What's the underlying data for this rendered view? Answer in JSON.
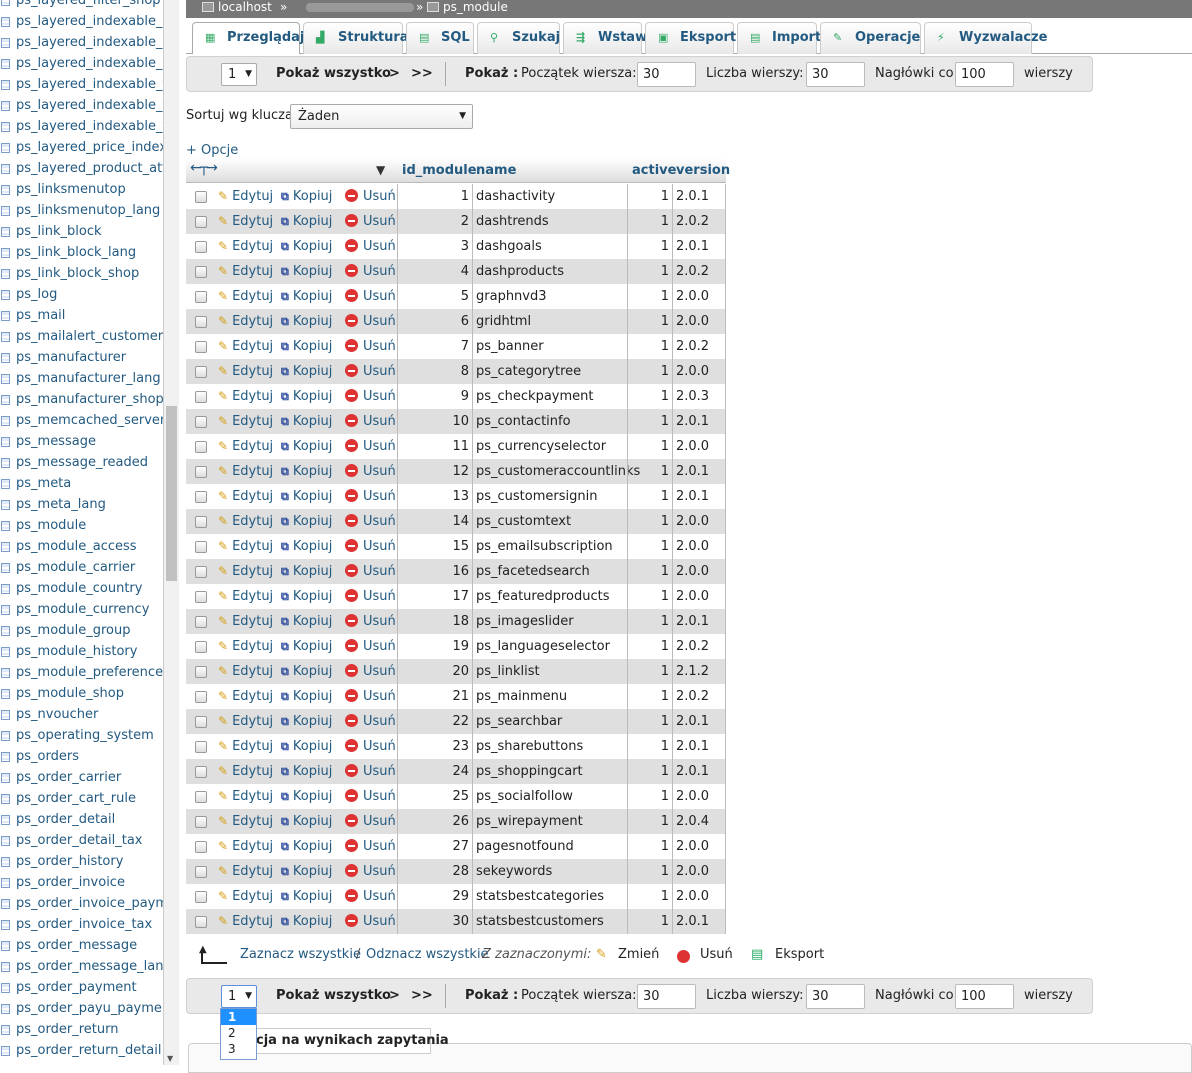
{
  "sidebar": {
    "tables": [
      "ps_layered_filter_shop",
      "ps_layered_indexable_attr",
      "ps_layered_indexable_attr",
      "ps_layered_indexable_attr",
      "ps_layered_indexable_feat",
      "ps_layered_indexable_feat",
      "ps_layered_indexable_feat",
      "ps_layered_price_index",
      "ps_layered_product_attrib",
      "ps_linksmenutop",
      "ps_linksmenutop_lang",
      "ps_link_block",
      "ps_link_block_lang",
      "ps_link_block_shop",
      "ps_log",
      "ps_mail",
      "ps_mailalert_customer_oos",
      "ps_manufacturer",
      "ps_manufacturer_lang",
      "ps_manufacturer_shop",
      "ps_memcached_servers",
      "ps_message",
      "ps_message_readed",
      "ps_meta",
      "ps_meta_lang",
      "ps_module",
      "ps_module_access",
      "ps_module_carrier",
      "ps_module_country",
      "ps_module_currency",
      "ps_module_group",
      "ps_module_history",
      "ps_module_preference",
      "ps_module_shop",
      "ps_nvoucher",
      "ps_operating_system",
      "ps_orders",
      "ps_order_carrier",
      "ps_order_cart_rule",
      "ps_order_detail",
      "ps_order_detail_tax",
      "ps_order_history",
      "ps_order_invoice",
      "ps_order_invoice_payment",
      "ps_order_invoice_tax",
      "ps_order_message",
      "ps_order_message_lang",
      "ps_order_payment",
      "ps_order_payu_payments",
      "ps_order_return",
      "ps_order_return_detail"
    ]
  },
  "breadcrumb": {
    "server": "localhost",
    "sep1": "»",
    "sep2": "»",
    "table": "ps_module"
  },
  "tabs": [
    {
      "label": "Przeglądaj",
      "icon": "browse-icon"
    },
    {
      "label": "Struktura",
      "icon": "structure-icon"
    },
    {
      "label": "SQL",
      "icon": "sql-icon"
    },
    {
      "label": "Szukaj",
      "icon": "search-icon"
    },
    {
      "label": "Wstaw",
      "icon": "insert-icon"
    },
    {
      "label": "Eksport",
      "icon": "export-icon"
    },
    {
      "label": "Import",
      "icon": "import-icon"
    },
    {
      "label": "Operacje",
      "icon": "operations-icon"
    },
    {
      "label": "Wyzwalacze",
      "icon": "triggers-icon"
    }
  ],
  "nav": {
    "page": "1",
    "show_all": "Pokaż wszystko",
    "next": ">",
    "last": ">>",
    "show": "Pokaż :",
    "start_label": "Początek wiersza:",
    "start_value": "30",
    "count_label": "Liczba wierszy:",
    "count_value": "30",
    "headers_label": "Nagłówki co",
    "headers_value": "100",
    "rows_word": "wierszy"
  },
  "sort": {
    "label": "Sortuj wg klucza:",
    "value": "Żaden"
  },
  "options_link": "+ Opcje",
  "columns": {
    "id": "id_module",
    "name": "name",
    "active": "active",
    "version": "version"
  },
  "row_actions": {
    "edit": "Edytuj",
    "copy": "Kopiuj",
    "delete": "Usuń"
  },
  "rows": [
    {
      "id": "1",
      "name": "dashactivity",
      "active": "1",
      "version": "2.0.1"
    },
    {
      "id": "2",
      "name": "dashtrends",
      "active": "1",
      "version": "2.0.2"
    },
    {
      "id": "3",
      "name": "dashgoals",
      "active": "1",
      "version": "2.0.1"
    },
    {
      "id": "4",
      "name": "dashproducts",
      "active": "1",
      "version": "2.0.2"
    },
    {
      "id": "5",
      "name": "graphnvd3",
      "active": "1",
      "version": "2.0.0"
    },
    {
      "id": "6",
      "name": "gridhtml",
      "active": "1",
      "version": "2.0.0"
    },
    {
      "id": "7",
      "name": "ps_banner",
      "active": "1",
      "version": "2.0.2"
    },
    {
      "id": "8",
      "name": "ps_categorytree",
      "active": "1",
      "version": "2.0.0"
    },
    {
      "id": "9",
      "name": "ps_checkpayment",
      "active": "1",
      "version": "2.0.3"
    },
    {
      "id": "10",
      "name": "ps_contactinfo",
      "active": "1",
      "version": "2.0.1"
    },
    {
      "id": "11",
      "name": "ps_currencyselector",
      "active": "1",
      "version": "2.0.0"
    },
    {
      "id": "12",
      "name": "ps_customeraccountlinks",
      "active": "1",
      "version": "2.0.1"
    },
    {
      "id": "13",
      "name": "ps_customersignin",
      "active": "1",
      "version": "2.0.1"
    },
    {
      "id": "14",
      "name": "ps_customtext",
      "active": "1",
      "version": "2.0.0"
    },
    {
      "id": "15",
      "name": "ps_emailsubscription",
      "active": "1",
      "version": "2.0.0"
    },
    {
      "id": "16",
      "name": "ps_facetedsearch",
      "active": "1",
      "version": "2.0.0"
    },
    {
      "id": "17",
      "name": "ps_featuredproducts",
      "active": "1",
      "version": "2.0.0"
    },
    {
      "id": "18",
      "name": "ps_imageslider",
      "active": "1",
      "version": "2.0.1"
    },
    {
      "id": "19",
      "name": "ps_languageselector",
      "active": "1",
      "version": "2.0.2"
    },
    {
      "id": "20",
      "name": "ps_linklist",
      "active": "1",
      "version": "2.1.2"
    },
    {
      "id": "21",
      "name": "ps_mainmenu",
      "active": "1",
      "version": "2.0.2"
    },
    {
      "id": "22",
      "name": "ps_searchbar",
      "active": "1",
      "version": "2.0.1"
    },
    {
      "id": "23",
      "name": "ps_sharebuttons",
      "active": "1",
      "version": "2.0.1"
    },
    {
      "id": "24",
      "name": "ps_shoppingcart",
      "active": "1",
      "version": "2.0.1"
    },
    {
      "id": "25",
      "name": "ps_socialfollow",
      "active": "1",
      "version": "2.0.0"
    },
    {
      "id": "26",
      "name": "ps_wirepayment",
      "active": "1",
      "version": "2.0.4"
    },
    {
      "id": "27",
      "name": "pagesnotfound",
      "active": "1",
      "version": "2.0.0"
    },
    {
      "id": "28",
      "name": "sekeywords",
      "active": "1",
      "version": "2.0.0"
    },
    {
      "id": "29",
      "name": "statsbestcategories",
      "active": "1",
      "version": "2.0.0"
    },
    {
      "id": "30",
      "name": "statsbestcustomers",
      "active": "1",
      "version": "2.0.1"
    }
  ],
  "bulk": {
    "check_all": "Zaznacz wszystkie",
    "slash": "/",
    "uncheck_all": "Odznacz wszystkie",
    "with_selected": "Z zaznaczonymi:",
    "change": "Zmień",
    "delete": "Usuń",
    "export": "Eksport"
  },
  "page_dropdown": {
    "options": [
      "1",
      "2",
      "3"
    ],
    "selected": "1"
  },
  "tooltip": "cja na wynikach zapytania"
}
